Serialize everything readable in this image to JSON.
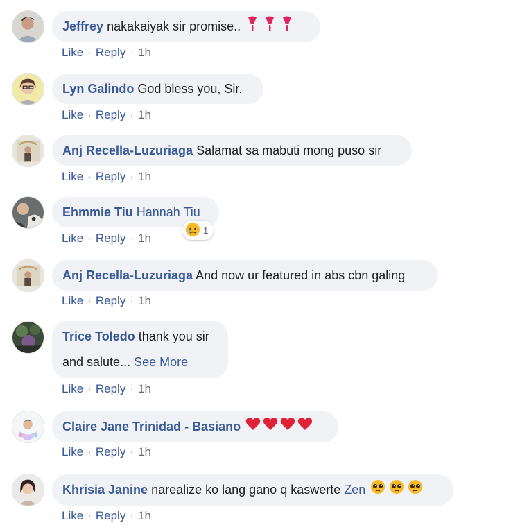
{
  "actions": {
    "like": "Like",
    "reply": "Reply",
    "sep": "·"
  },
  "comments": [
    {
      "author": "Jeffrey",
      "text": "nakakaiyak sir promise..",
      "time": "1h",
      "emoji": "heart-exclamation x3"
    },
    {
      "author": "Lyn Galindo",
      "text": "God bless you, Sir.",
      "time": "1h"
    },
    {
      "author": "Anj Recella-Luzuriaga",
      "text": "Salamat sa mabuti mong puso sir",
      "time": "1h"
    },
    {
      "author": "Ehmmie Tiu",
      "text": "",
      "tag": "Hannah Tiu",
      "time": "1h",
      "reaction_count": "1"
    },
    {
      "author": "Anj Recella-Luzuriaga",
      "text": "And now ur featured in abs cbn galing",
      "time": "1h"
    },
    {
      "author": "Trice Toledo",
      "text": "thank you sir",
      "text2": "and salute...",
      "see_more": "See More",
      "time": "1h"
    },
    {
      "author": "Claire Jane Trinidad - Basiano",
      "text": "",
      "time": "1h",
      "emoji": "red-heart x4"
    },
    {
      "author": "Khrisia Janine",
      "text": "narealize ko lang gano q kaswerte",
      "tag": "Zen",
      "time": "1h",
      "emoji": "pleading-face x3"
    }
  ]
}
